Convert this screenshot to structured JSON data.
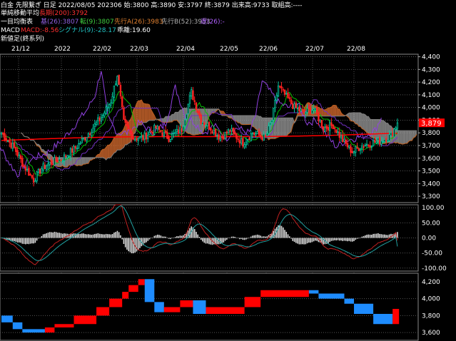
{
  "header": {
    "line1": "白金 先限繋ぎ 日足 2022/08/05 202306 始:3800 高:3890 安:3797 終:3879 出来高:9733 取組高:----",
    "line2_label": "単純移動平均",
    "line2_value": "長期(200):3792",
    "line3_label": "一目均衡表",
    "line3_base": "基(26):3807",
    "line3_conv": "転(9):3807",
    "line3_spanA": "先行A(26):3983",
    "line3_spanB": "先行B(52):3953",
    "line3_lag": "遅(26):-",
    "line4_label": "MACD",
    "line4_macd": "MACD:-8.56",
    "line4_signal": "シグナル(9):-28.17",
    "line4_osc": "乖離:19.60",
    "line5_label": "新値足(終系列)"
  },
  "colors": {
    "background": "#000000",
    "grid": "#555555",
    "up": "#00c8a0",
    "down": "#ff2020",
    "ma": "#ff0000",
    "conv": "#00c000",
    "base": "#7030c0",
    "lag": "#9040e0",
    "kumo_up": "#e07030",
    "kumo_down": "#a0a0a0",
    "macd": "#c02020",
    "signal": "#20a0a0",
    "osc": "#dddddd",
    "nb_up": "#ff0000",
    "nb_down": "#1e8cff",
    "last_price_box": "#ff0000"
  },
  "dates": [
    "21/12",
    "2022",
    "22/02",
    "22/03",
    "22/04",
    "22/05",
    "22/06",
    "22/07",
    "22/08"
  ],
  "price_axis": [
    "4,400",
    "4,300",
    "4,200",
    "4,100",
    "4,000",
    "3,900",
    "3,800",
    "3,700",
    "3,600",
    "3,500",
    "3,400",
    "3,300"
  ],
  "last_price": "3,879",
  "macd_axis": [
    "100.00",
    "50.00",
    "0.00",
    "-50.00",
    "-100.00"
  ],
  "nb_axis": [
    "4,200",
    "4,000",
    "3,800",
    "3,600"
  ],
  "chart_data": [
    {
      "type": "candlestick",
      "panel": "price",
      "ylim": [
        3250,
        4420
      ],
      "last_close": 3879,
      "ma200": 3792,
      "anchors_close": [
        [
          0,
          3800
        ],
        [
          8,
          3680
        ],
        [
          14,
          3540
        ],
        [
          20,
          3430
        ],
        [
          25,
          3520
        ],
        [
          30,
          3560
        ],
        [
          38,
          3600
        ],
        [
          46,
          3680
        ],
        [
          53,
          3780
        ],
        [
          58,
          3860
        ],
        [
          63,
          3940
        ],
        [
          68,
          4050
        ],
        [
          72,
          4260
        ],
        [
          76,
          3880
        ],
        [
          82,
          3760
        ],
        [
          88,
          3760
        ],
        [
          96,
          3840
        ],
        [
          104,
          3760
        ],
        [
          112,
          3830
        ],
        [
          118,
          4120
        ],
        [
          124,
          3900
        ],
        [
          130,
          3840
        ],
        [
          136,
          3760
        ],
        [
          142,
          3820
        ],
        [
          150,
          3720
        ],
        [
          156,
          3800
        ],
        [
          164,
          3760
        ],
        [
          168,
          3900
        ],
        [
          172,
          4170
        ],
        [
          176,
          4100
        ],
        [
          182,
          4000
        ],
        [
          188,
          3960
        ],
        [
          194,
          3990
        ],
        [
          200,
          3840
        ],
        [
          206,
          3860
        ],
        [
          212,
          3740
        ],
        [
          218,
          3650
        ],
        [
          224,
          3700
        ],
        [
          230,
          3720
        ],
        [
          236,
          3740
        ],
        [
          242,
          3780
        ],
        [
          246,
          3879
        ]
      ]
    },
    {
      "type": "line",
      "panel": "macd",
      "ylim": [
        -110,
        110
      ],
      "last_macd": -8.56,
      "last_signal": -28.17,
      "last_osc": 19.6
    },
    {
      "type": "bar",
      "panel": "new-price-bars",
      "ylim": [
        3500,
        4300
      ],
      "blocks": [
        [
          0,
          6,
          3800,
          3720,
          "down"
        ],
        [
          7,
          12,
          3720,
          3640,
          "down"
        ],
        [
          13,
          26,
          3640,
          3600,
          "down"
        ],
        [
          27,
          32,
          3600,
          3660,
          "up"
        ],
        [
          33,
          44,
          3660,
          3700,
          "up"
        ],
        [
          45,
          58,
          3700,
          3800,
          "up"
        ],
        [
          59,
          66,
          3800,
          3900,
          "up"
        ],
        [
          67,
          74,
          3900,
          4000,
          "up"
        ],
        [
          75,
          78,
          4000,
          4080,
          "up"
        ],
        [
          79,
          84,
          4080,
          4160,
          "up"
        ],
        [
          85,
          88,
          4160,
          4230,
          "up"
        ],
        [
          89,
          94,
          4230,
          3960,
          "down"
        ],
        [
          95,
          100,
          3960,
          3840,
          "down"
        ],
        [
          101,
          110,
          3840,
          3900,
          "up"
        ],
        [
          111,
          118,
          3900,
          3980,
          "up"
        ],
        [
          119,
          126,
          3980,
          3820,
          "down"
        ],
        [
          127,
          150,
          3820,
          3900,
          "up"
        ],
        [
          151,
          160,
          3900,
          4020,
          "up"
        ],
        [
          161,
          190,
          4020,
          4100,
          "up"
        ],
        [
          191,
          196,
          4100,
          4060,
          "down"
        ],
        [
          197,
          212,
          4060,
          4000,
          "down"
        ],
        [
          213,
          218,
          4000,
          3940,
          "down"
        ],
        [
          219,
          230,
          3940,
          3820,
          "down"
        ],
        [
          231,
          242,
          3820,
          3700,
          "down"
        ],
        [
          243,
          246,
          3700,
          3879,
          "up"
        ]
      ]
    }
  ]
}
